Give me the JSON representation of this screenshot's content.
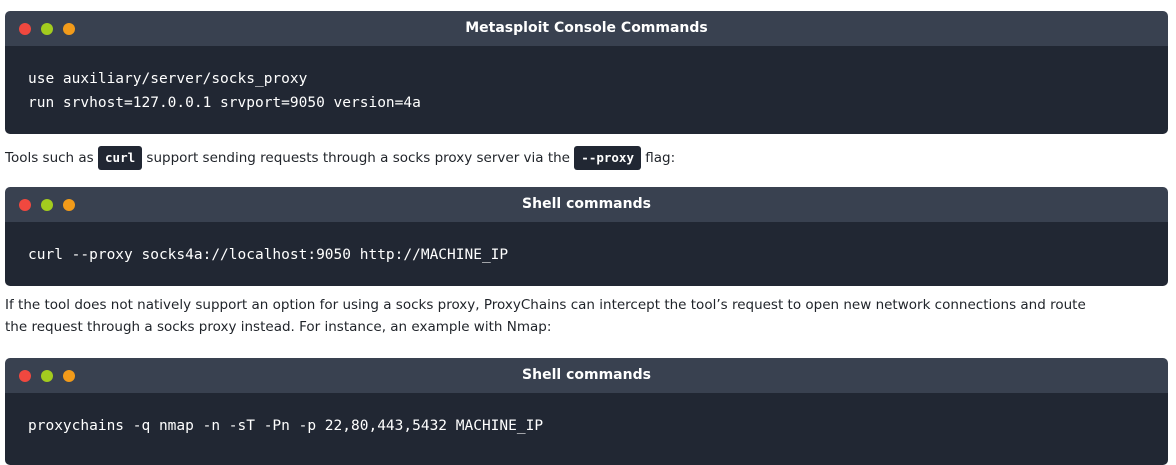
{
  "blocks": [
    {
      "title": "Metasploit Console Commands",
      "lines": [
        "use auxiliary/server/socks_proxy",
        "run srvhost=127.0.0.1 srvport=9050 version=4a"
      ]
    },
    {
      "title": "Shell commands",
      "lines": [
        "curl --proxy socks4a://localhost:9050 http://MACHINE_IP"
      ]
    },
    {
      "title": "Shell commands",
      "lines": [
        "proxychains -q nmap -n -sT -Pn -p 22,80,443,5432 MACHINE_IP"
      ]
    }
  ],
  "para1": {
    "before": "Tools such as ",
    "code1": "curl",
    "middle": " support sending requests through a socks proxy server via the ",
    "code2": "--proxy",
    "after": " flag:"
  },
  "para2": {
    "line1": "If the tool does not natively support an option for using a socks proxy, ProxyChains can intercept the tool’s request to open new network connections and route",
    "line2": "the request through a socks proxy instead. For instance, an example with Nmap:"
  },
  "colors": {
    "header_bg": "#394150",
    "body_bg": "#212733",
    "dot_red": "#f0483f",
    "dot_green": "#a3cc1e",
    "dot_orange": "#f29b1a"
  },
  "icons": [
    "close-dot-icon",
    "minimize-dot-icon",
    "maximize-dot-icon"
  ]
}
